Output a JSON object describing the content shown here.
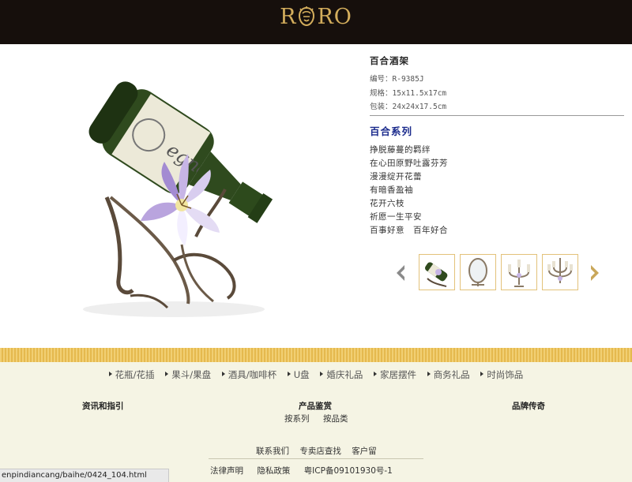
{
  "header": {
    "logo_left": "R",
    "logo_right": "RO"
  },
  "product": {
    "title": "百合酒架",
    "specs": [
      {
        "label": "编号：",
        "value": "R-9385J"
      },
      {
        "label": "规格：",
        "value": "15x11.5x17cm"
      },
      {
        "label": "包装：",
        "value": "24x24x17.5cm"
      }
    ],
    "series_title": "百合系列",
    "description_lines": [
      "挣脱藤蔓的羁绊",
      "在心田原野吐露芬芳",
      "漫漫绽开花蕾",
      "有暗香盈袖",
      "花开六枝",
      "祈愿一生平安",
      "百事好意　百年好合"
    ]
  },
  "gallery": {
    "thumbnails": [
      {
        "icon": "wine-rack-thumb"
      },
      {
        "icon": "mirror-thumb"
      },
      {
        "icon": "candelabra-thumb"
      },
      {
        "icon": "chandelier-thumb"
      }
    ]
  },
  "footer": {
    "categories": [
      "花瓶/花插",
      "果斗/果盘",
      "酒具/咖啡杯",
      "U盘",
      "婚庆礼品",
      "家居摆件",
      "商务礼品",
      "时尚饰品"
    ],
    "columns": [
      {
        "title": "资讯和指引",
        "links": []
      },
      {
        "title": "产品鉴赏",
        "links": [
          "按系列",
          "按品类"
        ]
      },
      {
        "title": "品牌传奇",
        "links": []
      }
    ],
    "bottom_links": [
      "联系我们",
      "专卖店查找",
      "客户留"
    ],
    "legal": [
      "法律声明",
      "隐私政策",
      "粤ICP备09101930号-1"
    ]
  },
  "status_bar": {
    "url": "enpindiancang/baihe/0424_104.html"
  },
  "colors": {
    "header_bg": "#160f0c",
    "logo_gold": "#d3ad5c",
    "series_blue": "#1a2a8c",
    "gold_band": "#e5b94e",
    "footer_bg": "#f5f4e4"
  }
}
